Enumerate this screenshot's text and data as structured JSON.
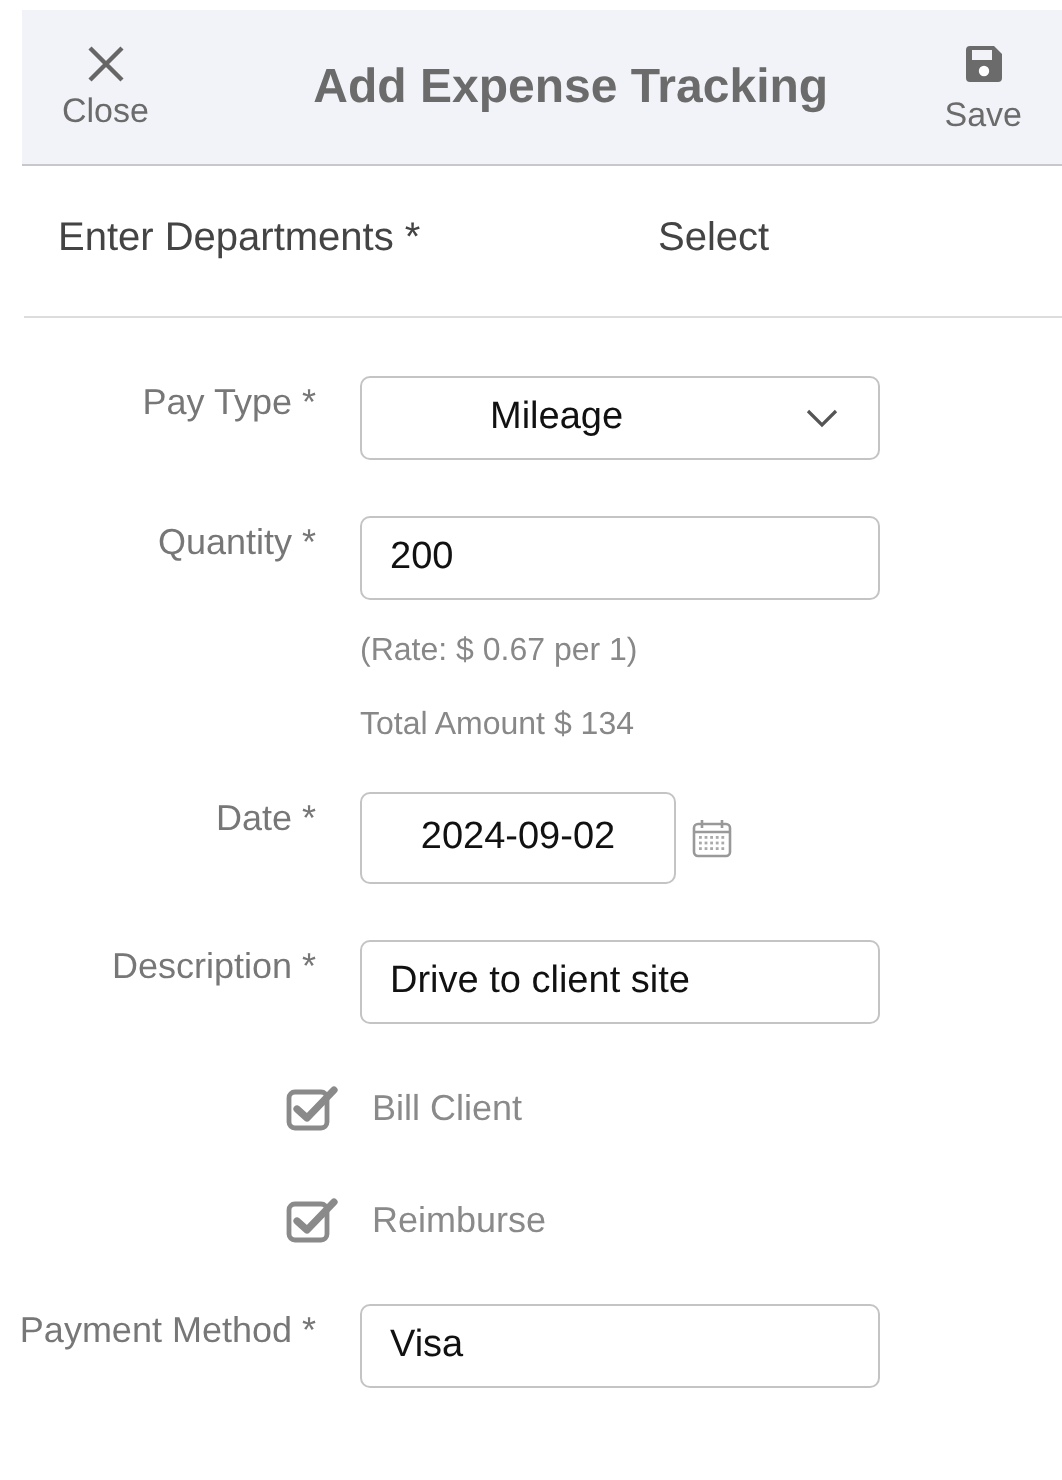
{
  "header": {
    "close_label": "Close",
    "title": "Add Expense Tracking",
    "save_label": "Save"
  },
  "departments": {
    "label": "Enter Departments *",
    "value": "Select"
  },
  "fields": [
    {
      "kind": "select",
      "label": "Pay Type *",
      "value": "Mileage"
    },
    {
      "kind": "input",
      "label": "Quantity *",
      "value": "200",
      "notes": [
        "(Rate: $ 0.67 per 1)",
        "Total Amount $ 134"
      ]
    },
    {
      "kind": "date",
      "label": "Date *",
      "value": "2024-09-02"
    },
    {
      "kind": "input",
      "label": "Description *",
      "value": "Drive to client site"
    },
    {
      "kind": "checkbox",
      "label": "Bill Client",
      "checked": true
    },
    {
      "kind": "checkbox",
      "label": "Reimburse",
      "checked": true
    },
    {
      "kind": "input",
      "label": "Payment Method *",
      "value": "Visa"
    }
  ]
}
